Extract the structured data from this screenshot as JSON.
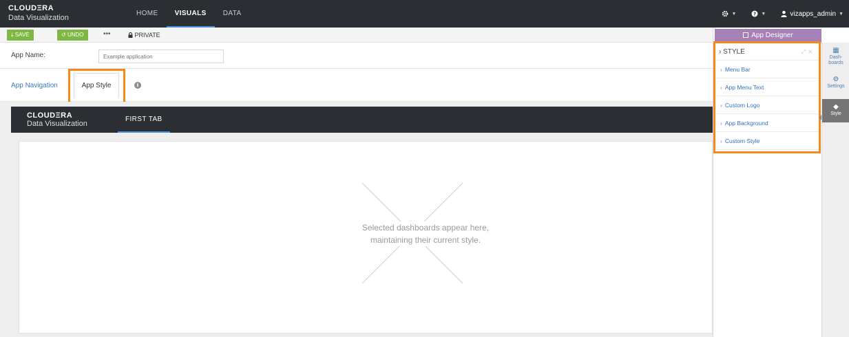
{
  "topnav": {
    "brand": "CLOUDΞRA",
    "subtitle": "Data Visualization",
    "tabs": [
      {
        "label": "HOME",
        "active": false
      },
      {
        "label": "VISUALS",
        "active": true
      },
      {
        "label": "DATA",
        "active": false
      }
    ],
    "settings_icon": "gear-icon",
    "help_icon": "question-circle-icon",
    "user": {
      "icon": "user-icon",
      "label": "vizapps_admin"
    }
  },
  "toolbar": {
    "save_label": "SAVE",
    "undo_label": "UNDO",
    "more_label": "•••",
    "private_label": "PRIVATE",
    "save_icon": "download-icon",
    "undo_icon": "undo-icon",
    "private_icon": "lock-icon",
    "accent_color": "#7fb743"
  },
  "app_name": {
    "label": "App Name:",
    "value": "",
    "placeholder": "Example application"
  },
  "tabs": {
    "navigation_label": "App Navigation",
    "style_label": "App Style",
    "info_icon": "info-circle-icon",
    "highlight_color": "#f4891f"
  },
  "preview": {
    "brand": "CLOUDΞRA",
    "subtitle": "Data Visualization",
    "tab_label": "FIRST TAB",
    "placeholder_line1": "Selected dashboards appear here,",
    "placeholder_line2": "maintaining their current style."
  },
  "designer": {
    "header_label": "App Designer",
    "header_color": "#a880b8",
    "style_title": "STYLE",
    "items": [
      {
        "label": "Menu Bar"
      },
      {
        "label": "App Menu Text"
      },
      {
        "label": "Custom Logo"
      },
      {
        "label": "App Background"
      },
      {
        "label": "Custom Style"
      }
    ]
  },
  "rail": {
    "dashboards_line1": "Dash-",
    "dashboards_line2": "boards",
    "settings_label": "Settings",
    "style_label": "Style",
    "icons": [
      "dashboards-icon",
      "settings-icon",
      "diamond-icon"
    ]
  }
}
